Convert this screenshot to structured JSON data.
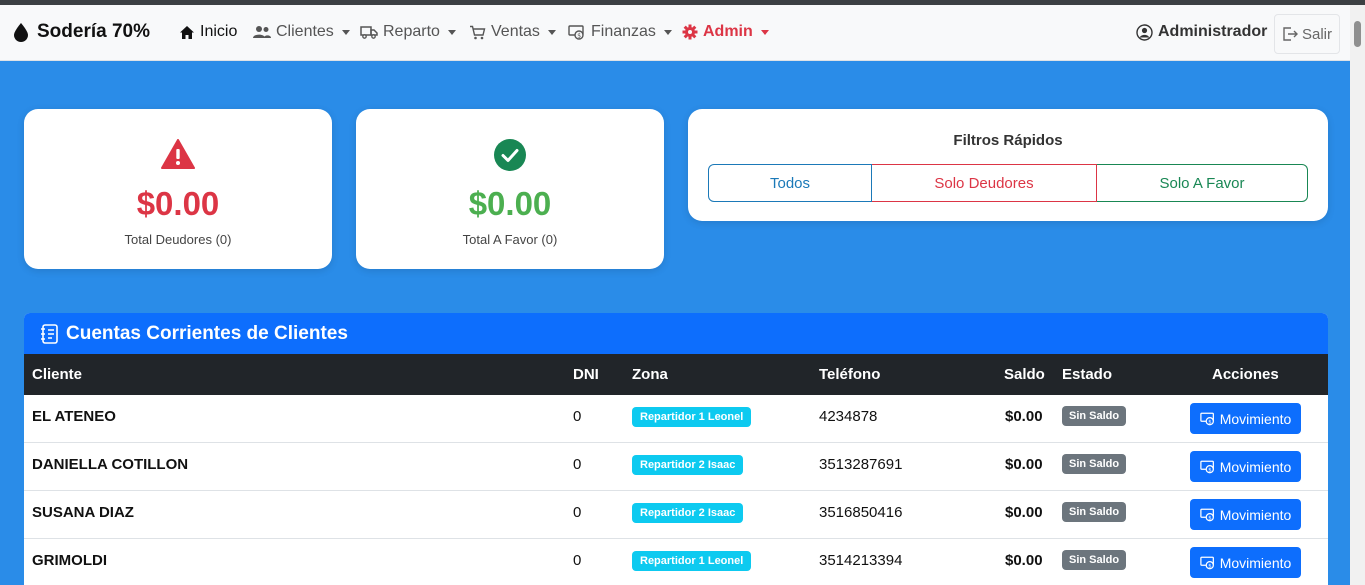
{
  "colors": {
    "background": "#2a8ce8",
    "primary": "#0d6efd",
    "danger": "#dc3545",
    "success": "#198754",
    "info": "#0dcaf0",
    "secondary": "#6c757d",
    "dark": "#212529"
  },
  "navbar": {
    "brand": "Sodería 70%",
    "brand_icon": "droplet-icon",
    "items": [
      {
        "label": "Inicio",
        "icon": "home-icon"
      },
      {
        "label": "Clientes",
        "icon": "users-icon"
      },
      {
        "label": "Reparto",
        "icon": "truck-icon"
      },
      {
        "label": "Ventas",
        "icon": "cart-icon"
      },
      {
        "label": "Finanzas",
        "icon": "money-icon"
      },
      {
        "label": "Admin",
        "icon": "gear-icon"
      }
    ],
    "user": "Administrador",
    "logout": "Salir"
  },
  "stats": {
    "deudores": {
      "value": "$0.00",
      "label": "Total Deudores (0)",
      "icon": "warning-icon"
    },
    "favor": {
      "value": "$0.00",
      "label": "Total A Favor (0)",
      "icon": "check-circle-icon"
    }
  },
  "filtros": {
    "title": "Filtros Rápidos",
    "buttons": [
      "Todos",
      "Solo Deudores",
      "Solo A Favor"
    ]
  },
  "table": {
    "title": "Cuentas Corrientes de Clientes",
    "columns": [
      "Cliente",
      "DNI",
      "Zona",
      "Teléfono",
      "Saldo",
      "Estado",
      "Acciones"
    ],
    "action_label": "Movimiento",
    "rows": [
      {
        "cliente": "EL ATENEO",
        "dni": "0",
        "zona": "Repartidor 1 Leonel",
        "telefono": "4234878",
        "saldo": "$0.00",
        "estado": "Sin Saldo"
      },
      {
        "cliente": "DANIELLA COTILLON",
        "dni": "0",
        "zona": "Repartidor 2 Isaac",
        "telefono": "3513287691",
        "saldo": "$0.00",
        "estado": "Sin Saldo"
      },
      {
        "cliente": "SUSANA DIAZ",
        "dni": "0",
        "zona": "Repartidor 2 Isaac",
        "telefono": "3516850416",
        "saldo": "$0.00",
        "estado": "Sin Saldo"
      },
      {
        "cliente": "GRIMOLDI",
        "dni": "0",
        "zona": "Repartidor 1 Leonel",
        "telefono": "3514213394",
        "saldo": "$0.00",
        "estado": "Sin Saldo"
      }
    ]
  }
}
